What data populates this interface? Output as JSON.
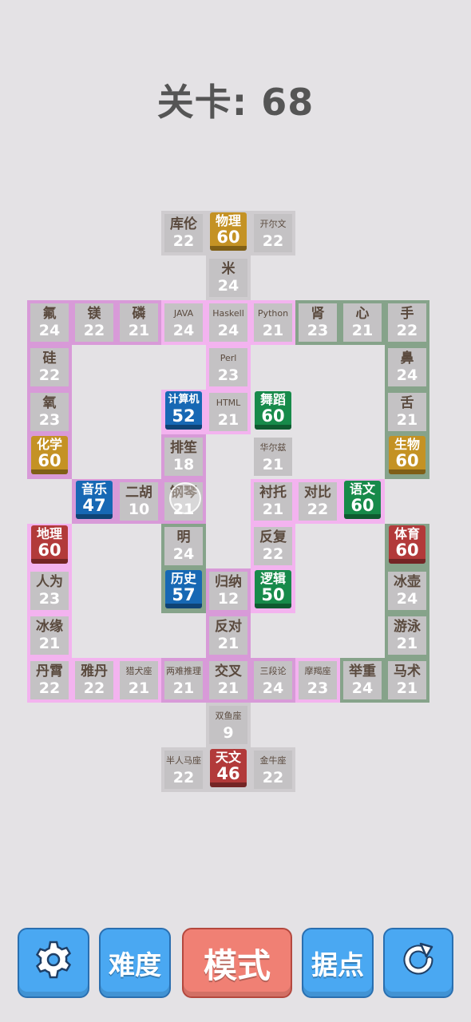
{
  "header": {
    "title": "关卡: 68"
  },
  "colors": {
    "pink": "#f3b3ef",
    "purple": "#d89ad8",
    "green": "#86a38a",
    "gray_tile": "#c4c2c4",
    "yellow": "#c49224",
    "blue": "#1768b4",
    "green_tile": "#178a4a",
    "red": "#b23a3a"
  },
  "regions": [
    {
      "name": "physics-top",
      "color": "#cfcccf",
      "cells": [
        [
          4,
          0
        ],
        [
          5,
          0
        ],
        [
          6,
          0
        ],
        [
          5,
          1
        ]
      ]
    },
    {
      "name": "chem-left",
      "color": "#d89ad8",
      "cells": [
        [
          1,
          2
        ],
        [
          2,
          2
        ],
        [
          3,
          2
        ],
        [
          1,
          3
        ],
        [
          1,
          4
        ],
        [
          1,
          5
        ]
      ]
    },
    {
      "name": "computer-tree",
      "color": "#f3b3ef",
      "cells": [
        [
          4,
          2
        ],
        [
          5,
          2
        ],
        [
          6,
          2
        ],
        [
          5,
          3
        ],
        [
          4,
          4
        ],
        [
          5,
          4
        ]
      ]
    },
    {
      "name": "biology-right",
      "color": "#86a38a",
      "cells": [
        [
          7,
          2
        ],
        [
          8,
          2
        ],
        [
          9,
          2
        ],
        [
          9,
          3
        ],
        [
          9,
          4
        ],
        [
          9,
          5
        ]
      ]
    },
    {
      "name": "dance-region",
      "color": "#e4e2e5",
      "cells": [
        [
          6,
          4
        ],
        [
          6,
          5
        ]
      ]
    },
    {
      "name": "music-region",
      "color": "#d89ad8",
      "cells": [
        [
          2,
          6
        ],
        [
          3,
          6
        ],
        [
          4,
          5
        ],
        [
          4,
          6
        ]
      ]
    },
    {
      "name": "chinese-region",
      "color": "#f3b3ef",
      "cells": [
        [
          6,
          6
        ],
        [
          7,
          6
        ],
        [
          8,
          6
        ]
      ]
    },
    {
      "name": "geo-left",
      "color": "#f3b3ef",
      "cells": [
        [
          1,
          7
        ],
        [
          1,
          8
        ],
        [
          1,
          9
        ],
        [
          1,
          10
        ],
        [
          2,
          10
        ]
      ]
    },
    {
      "name": "history-region",
      "color": "#86a38a",
      "cells": [
        [
          4,
          7
        ],
        [
          4,
          8
        ]
      ]
    },
    {
      "name": "logic-region",
      "color": "#f3b3ef",
      "cells": [
        [
          6,
          7
        ],
        [
          6,
          8
        ]
      ]
    },
    {
      "name": "deduct-region",
      "color": "#d89ad8",
      "cells": [
        [
          5,
          8
        ],
        [
          5,
          9
        ],
        [
          5,
          10
        ],
        [
          4,
          10
        ],
        [
          6,
          10
        ]
      ]
    },
    {
      "name": "dog-region",
      "color": "#f3b3ef",
      "cells": [
        [
          3,
          10
        ]
      ]
    },
    {
      "name": "capri-region",
      "color": "#f3b3ef",
      "cells": [
        [
          7,
          10
        ]
      ]
    },
    {
      "name": "pe-right",
      "color": "#86a38a",
      "cells": [
        [
          9,
          7
        ],
        [
          9,
          8
        ],
        [
          9,
          9
        ],
        [
          9,
          10
        ],
        [
          8,
          10
        ]
      ]
    },
    {
      "name": "astro-bottom",
      "color": "#cfcccf",
      "cells": [
        [
          5,
          11
        ],
        [
          5,
          12
        ],
        [
          4,
          12
        ],
        [
          6,
          12
        ]
      ]
    }
  ],
  "cells": [
    {
      "c": 4,
      "r": 0,
      "label": "库伦",
      "value": "22"
    },
    {
      "c": 5,
      "r": 0,
      "label": "物理",
      "value": "60",
      "big": "#c49224"
    },
    {
      "c": 6,
      "r": 0,
      "label": "开尔文",
      "value": "22",
      "small": true
    },
    {
      "c": 5,
      "r": 1,
      "label": "米",
      "value": "24"
    },
    {
      "c": 1,
      "r": 2,
      "label": "氟",
      "value": "24"
    },
    {
      "c": 2,
      "r": 2,
      "label": "镁",
      "value": "22"
    },
    {
      "c": 3,
      "r": 2,
      "label": "磷",
      "value": "21"
    },
    {
      "c": 4,
      "r": 2,
      "label": "JAVA",
      "value": "24",
      "small": true
    },
    {
      "c": 5,
      "r": 2,
      "label": "Haskell",
      "value": "24",
      "small": true
    },
    {
      "c": 6,
      "r": 2,
      "label": "Python",
      "value": "21",
      "small": true
    },
    {
      "c": 7,
      "r": 2,
      "label": "肾",
      "value": "23"
    },
    {
      "c": 8,
      "r": 2,
      "label": "心",
      "value": "21"
    },
    {
      "c": 9,
      "r": 2,
      "label": "手",
      "value": "22"
    },
    {
      "c": 1,
      "r": 3,
      "label": "硅",
      "value": "22"
    },
    {
      "c": 5,
      "r": 3,
      "label": "Perl",
      "value": "23",
      "small": true
    },
    {
      "c": 9,
      "r": 3,
      "label": "鼻",
      "value": "24"
    },
    {
      "c": 1,
      "r": 4,
      "label": "氧",
      "value": "23"
    },
    {
      "c": 4,
      "r": 4,
      "label": "计算机",
      "value": "52",
      "big": "#1768b4",
      "small": true
    },
    {
      "c": 5,
      "r": 4,
      "label": "HTML",
      "value": "21",
      "small": true
    },
    {
      "c": 6,
      "r": 4,
      "label": "舞蹈",
      "value": "60",
      "big": "#178a4a"
    },
    {
      "c": 9,
      "r": 4,
      "label": "舌",
      "value": "21"
    },
    {
      "c": 1,
      "r": 5,
      "label": "化学",
      "value": "60",
      "big": "#c49224"
    },
    {
      "c": 4,
      "r": 5,
      "label": "排笙",
      "value": "18"
    },
    {
      "c": 6,
      "r": 5,
      "label": "华尔兹",
      "value": "21",
      "small": true
    },
    {
      "c": 9,
      "r": 5,
      "label": "生物",
      "value": "60",
      "big": "#c49224"
    },
    {
      "c": 2,
      "r": 6,
      "label": "音乐",
      "value": "47",
      "big": "#1768b4"
    },
    {
      "c": 3,
      "r": 6,
      "label": "二胡",
      "value": "10"
    },
    {
      "c": 4,
      "r": 6,
      "label": "钢琴",
      "value": "21"
    },
    {
      "c": 6,
      "r": 6,
      "label": "衬托",
      "value": "21"
    },
    {
      "c": 7,
      "r": 6,
      "label": "对比",
      "value": "22"
    },
    {
      "c": 8,
      "r": 6,
      "label": "语文",
      "value": "60",
      "big": "#178a4a"
    },
    {
      "c": 1,
      "r": 7,
      "label": "地理",
      "value": "60",
      "big": "#b23a3a"
    },
    {
      "c": 4,
      "r": 7,
      "label": "明",
      "value": "24"
    },
    {
      "c": 6,
      "r": 7,
      "label": "反复",
      "value": "22"
    },
    {
      "c": 9,
      "r": 7,
      "label": "体育",
      "value": "60",
      "big": "#b23a3a"
    },
    {
      "c": 1,
      "r": 8,
      "label": "人为",
      "value": "23"
    },
    {
      "c": 4,
      "r": 8,
      "label": "历史",
      "value": "57",
      "big": "#1768b4"
    },
    {
      "c": 5,
      "r": 8,
      "label": "归纳",
      "value": "12"
    },
    {
      "c": 6,
      "r": 8,
      "label": "逻辑",
      "value": "50",
      "big": "#178a4a"
    },
    {
      "c": 9,
      "r": 8,
      "label": "冰壶",
      "value": "24"
    },
    {
      "c": 1,
      "r": 9,
      "label": "冰缘",
      "value": "21"
    },
    {
      "c": 5,
      "r": 9,
      "label": "反对",
      "value": "21"
    },
    {
      "c": 9,
      "r": 9,
      "label": "游泳",
      "value": "21"
    },
    {
      "c": 1,
      "r": 10,
      "label": "丹霄",
      "value": "22"
    },
    {
      "c": 2,
      "r": 10,
      "label": "雅丹",
      "value": "22"
    },
    {
      "c": 3,
      "r": 10,
      "label": "猎犬座",
      "value": "21",
      "small": true
    },
    {
      "c": 4,
      "r": 10,
      "label": "两难推理",
      "value": "21",
      "small": true
    },
    {
      "c": 5,
      "r": 10,
      "label": "交叉",
      "value": "21"
    },
    {
      "c": 6,
      "r": 10,
      "label": "三段论",
      "value": "24",
      "small": true
    },
    {
      "c": 7,
      "r": 10,
      "label": "摩羯座",
      "value": "23",
      "small": true
    },
    {
      "c": 8,
      "r": 10,
      "label": "举重",
      "value": "24"
    },
    {
      "c": 9,
      "r": 10,
      "label": "马术",
      "value": "21"
    },
    {
      "c": 5,
      "r": 11,
      "label": "双鱼座",
      "value": "9",
      "small": true
    },
    {
      "c": 4,
      "r": 12,
      "label": "半人马座",
      "value": "22",
      "small": true
    },
    {
      "c": 5,
      "r": 12,
      "label": "天文",
      "value": "46",
      "big": "#b23a3a"
    },
    {
      "c": 6,
      "r": 12,
      "label": "金牛座",
      "value": "22",
      "small": true
    }
  ],
  "toolbar": {
    "settings_icon": "gear-icon",
    "difficulty_label": "难度",
    "mode_label": "模式",
    "stronghold_label": "据点",
    "refresh_icon": "refresh-icon"
  }
}
